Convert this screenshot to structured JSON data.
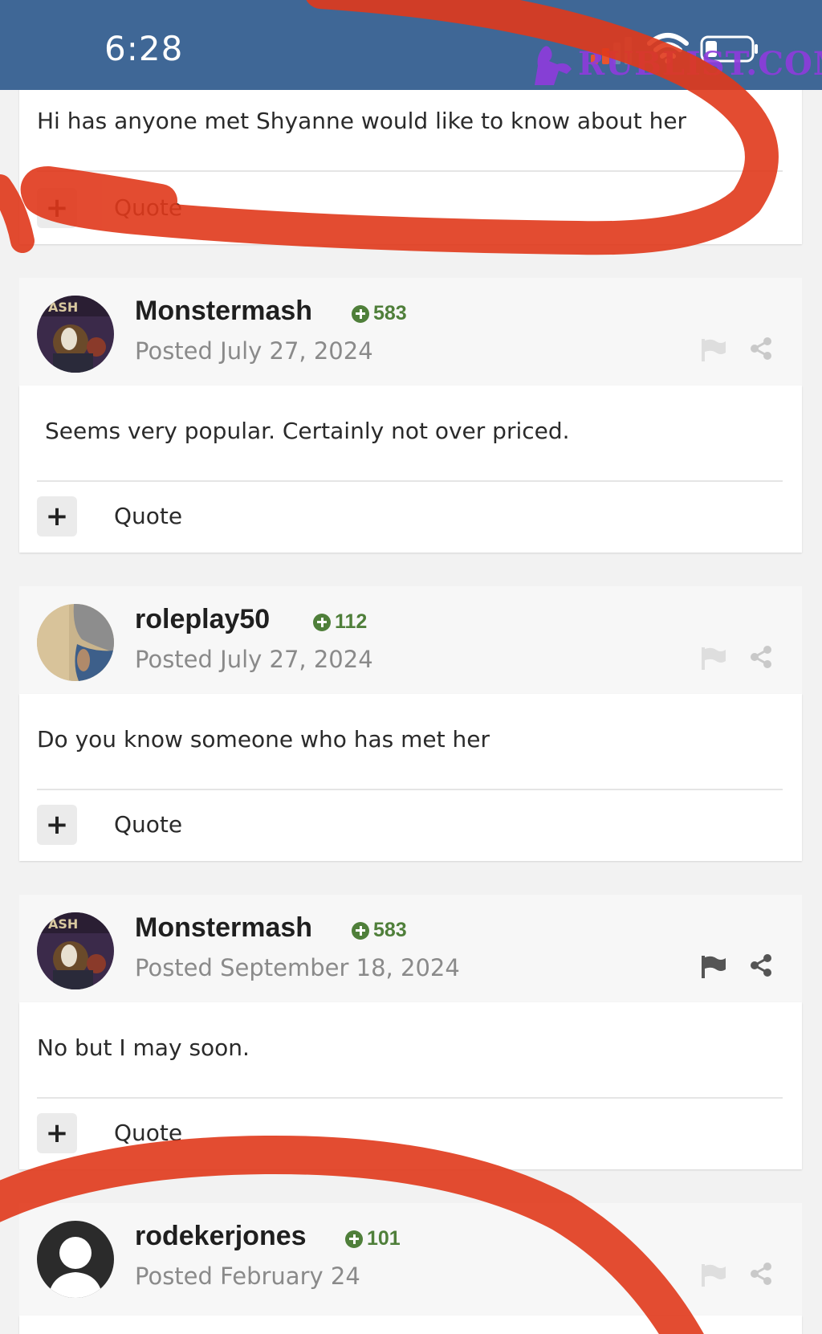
{
  "status_bar": {
    "time": "6:28",
    "watermark": "RUBLIST.COM"
  },
  "first_post": {
    "text": "Hi has anyone met Shyanne would like to know about her",
    "quote_label": "Quote"
  },
  "posts": [
    {
      "username": "Monstermash",
      "reputation": "583",
      "posted": "Posted July 27, 2024",
      "text": "Seems very popular. Certainly not over priced.",
      "quote_label": "Quote"
    },
    {
      "username": "roleplay50",
      "reputation": "112",
      "posted": "Posted July 27, 2024",
      "text": "Do you know someone who has met her",
      "quote_label": "Quote"
    },
    {
      "username": "Monstermash",
      "reputation": "583",
      "posted": "Posted September 18, 2024",
      "text": "No but I may soon.",
      "quote_label": "Quote"
    },
    {
      "username": "rodekerjones",
      "reputation": "101",
      "posted": "Posted February 24"
    }
  ],
  "colors": {
    "status_bar": "#3f6796",
    "reputation": "#4f7f3a",
    "annotation": "#e0381b",
    "watermark": "#8e3bdc"
  },
  "icons": [
    "plus-icon",
    "flag-icon",
    "share-icon",
    "reputation-plus-icon",
    "wifi-icon",
    "battery-icon",
    "signal-icon"
  ]
}
